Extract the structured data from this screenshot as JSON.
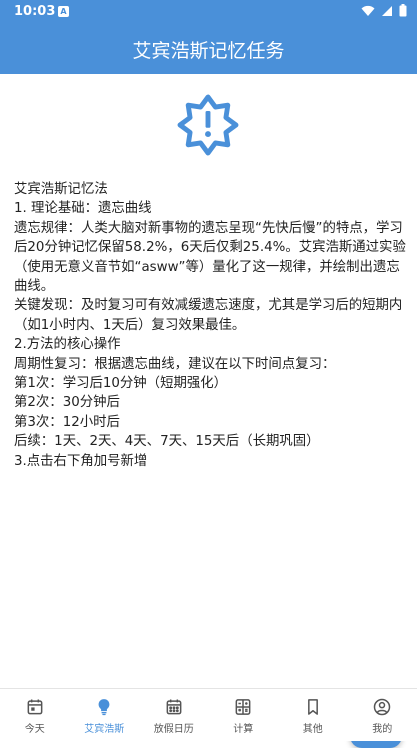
{
  "status_bar": {
    "time": "10:03",
    "notification_letter": "A"
  },
  "app_bar": {
    "title": "艾宾浩斯记忆任务"
  },
  "content": {
    "lines": [
      "艾宾浩斯记忆法",
      "1. 理论基础：遗忘曲线",
      "遗忘规律：人类大脑对新事物的遗忘呈现“先快后慢”的特点，学习后20分钟记忆保留58.2%，6天后仅剩25.4%。艾宾浩斯通过实验（使用无意义音节如“asww”等）量化了这一规律，并绘制出遗忘曲线。",
      "关键发现：及时复习可有效减缓遗忘速度，尤其是学习后的短期内（如1小时内、1天后）复习效果最佳。",
      "2.方法的核心操作",
      "周期性复习：根据遗忘曲线，建议在以下时间点复习：",
      "第1次：学习后10分钟（短期强化）",
      "第2次：30分钟后",
      "第3次：12小时后",
      "后续：1天、2天、4天、7天、15天后（长期巩固）",
      "3.点击右下角加号新增"
    ]
  },
  "nav": {
    "items": [
      {
        "label": "今天",
        "icon": "calendar-today-icon"
      },
      {
        "label": "艾宾浩斯",
        "icon": "lightbulb-icon"
      },
      {
        "label": "放假日历",
        "icon": "calendar-month-icon"
      },
      {
        "label": "计算",
        "icon": "calculator-icon"
      },
      {
        "label": "其他",
        "icon": "bookmark-icon"
      },
      {
        "label": "我的",
        "icon": "profile-icon"
      }
    ],
    "active_index": 1
  },
  "colors": {
    "primary": "#4a90d9",
    "nav_inactive": "#555555",
    "text": "#222222"
  }
}
